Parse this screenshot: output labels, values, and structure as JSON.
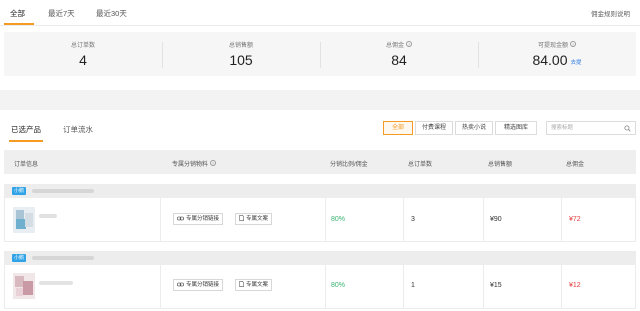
{
  "top_tabs": [
    {
      "label": "全部"
    },
    {
      "label": "最近7天"
    },
    {
      "label": "最近30天"
    }
  ],
  "rules_link": "佣金规则说明",
  "summary": {
    "total_orders": {
      "label": "总订单数",
      "value": "4"
    },
    "total_sales": {
      "label": "总销售额",
      "value": "105"
    },
    "total_commission": {
      "label": "总佣金",
      "value": "84"
    },
    "withdrawable": {
      "label": "可提现金额",
      "value": "84.00",
      "action": "去提"
    }
  },
  "section_tabs": [
    {
      "label": "已选产品"
    },
    {
      "label": "订单流水"
    }
  ],
  "filters": [
    {
      "label": "全部",
      "active": true
    },
    {
      "label": "付费课程",
      "active": false
    },
    {
      "label": "热卖小说",
      "active": false
    },
    {
      "label": "精选图库",
      "active": false
    }
  ],
  "search": {
    "placeholder": "搜索标题"
  },
  "table": {
    "headers": [
      "订单信息",
      "专属分销物料",
      "分销比例/佣金",
      "总订单数",
      "总销售额",
      "总佣金"
    ],
    "rows": [
      {
        "shop_badge": "小鹅",
        "distribution_link": "专属分销链接",
        "distribution_copy": "专属文案",
        "ratio": "80%",
        "orders": "3",
        "sales": "¥90",
        "commission": "¥72"
      },
      {
        "shop_badge": "小鹅",
        "distribution_link": "专属分销链接",
        "distribution_copy": "专属文案",
        "ratio": "80%",
        "orders": "1",
        "sales": "¥15",
        "commission": "¥12"
      }
    ]
  },
  "colors": {
    "accent": "#f59a23",
    "badge": "#2fa3e6",
    "ratio": "#3bb273",
    "commission": "#e23b3b"
  }
}
